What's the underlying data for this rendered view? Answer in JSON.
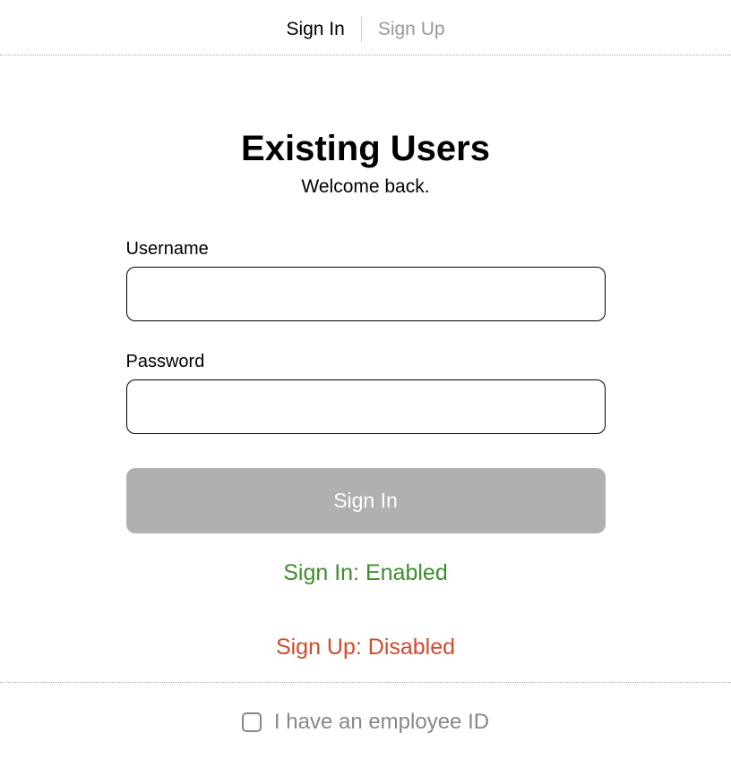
{
  "tabs": {
    "signin": "Sign In",
    "signup": "Sign Up"
  },
  "form": {
    "title": "Existing Users",
    "subtitle": "Welcome back.",
    "username_label": "Username",
    "username_value": "",
    "password_label": "Password",
    "password_value": "",
    "submit_label": "Sign In"
  },
  "status": {
    "signin": "Sign In: Enabled",
    "signup": "Sign Up: Disabled"
  },
  "employee": {
    "checkbox_checked": false,
    "label": "I have an employee ID"
  }
}
